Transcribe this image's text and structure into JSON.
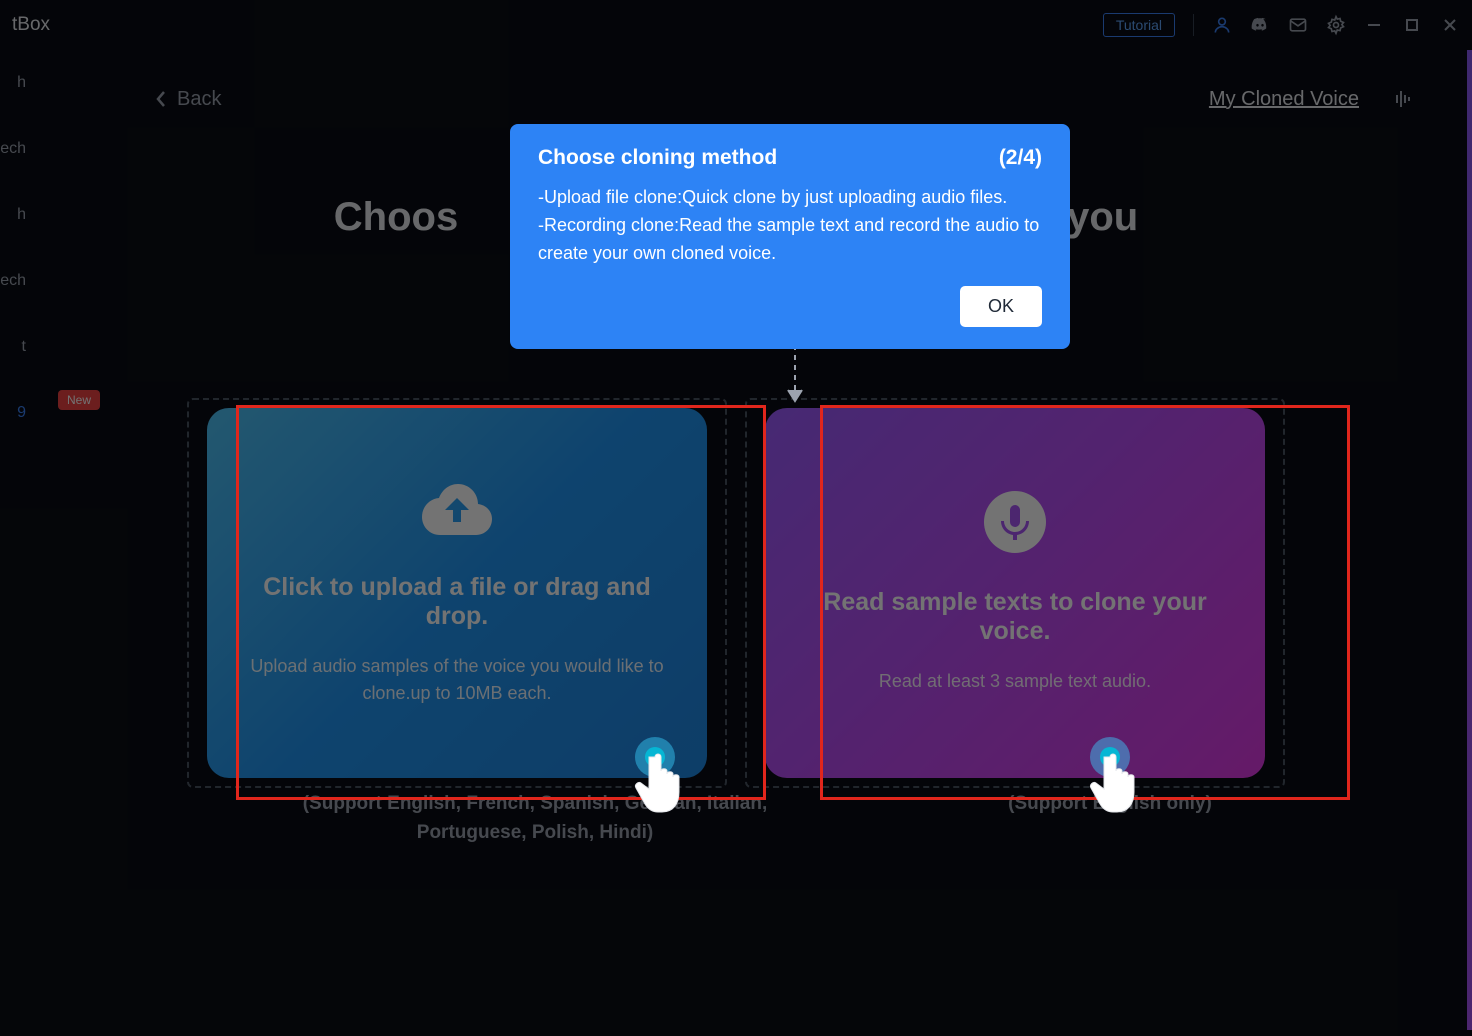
{
  "titlebar": {
    "app_name_fragment": "tBox",
    "tutorial_label": "Tutorial"
  },
  "sidebar": {
    "items": [
      {
        "label": "h"
      },
      {
        "label": "ech"
      },
      {
        "label": "h"
      },
      {
        "label": "ech"
      },
      {
        "label": "t"
      },
      {
        "label": "9",
        "badge": "New",
        "highlight": true
      }
    ]
  },
  "main": {
    "back_label": "Back",
    "cloned_voice_link": "My Cloned Voice",
    "page_title_prefix": "Choos",
    "page_title_suffix": "ts you"
  },
  "tutorial": {
    "title": "Choose cloning method",
    "step": "(2/4)",
    "line1": "-Upload file clone:Quick clone by just uploading audio files.",
    "line2": "-Recording clone:Read the sample text and record the audio to create your own cloned voice.",
    "ok_label": "OK"
  },
  "upload_card": {
    "title": "Click to upload a file or drag and drop.",
    "subtitle": "Upload audio samples of the voice you would like to clone.up to 10MB each.",
    "support": "(Support English, French, Spanish, German, Italian, Portuguese, Polish, Hindi)"
  },
  "record_card": {
    "title": "Read sample texts to clone your voice.",
    "subtitle": "Read at least 3 sample text audio.",
    "support": "(Support English only)"
  }
}
